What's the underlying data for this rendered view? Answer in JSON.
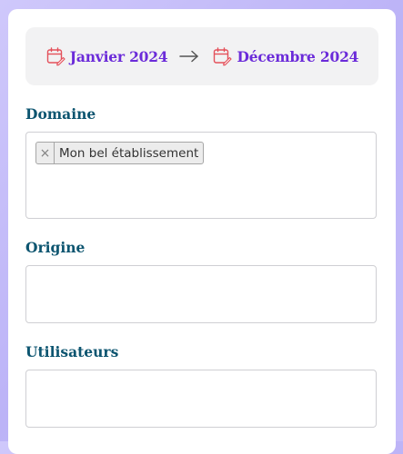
{
  "date_range": {
    "start_label": "Janvier 2024",
    "end_label": "Décembre 2024",
    "icon": "calendar-edit-icon",
    "separator_icon": "arrow-right-icon"
  },
  "fields": {
    "domaine": {
      "label": "Domaine",
      "tags": [
        {
          "remove": "×",
          "text": "Mon bel établissement"
        }
      ]
    },
    "origine": {
      "label": "Origine",
      "value": ""
    },
    "utilisateurs": {
      "label": "Utilisateurs",
      "value": ""
    }
  },
  "colors": {
    "accent": "#6b2bd9",
    "label": "#0d5570",
    "calendar_icon": "#e4515b",
    "background": "#c6bdf9"
  }
}
